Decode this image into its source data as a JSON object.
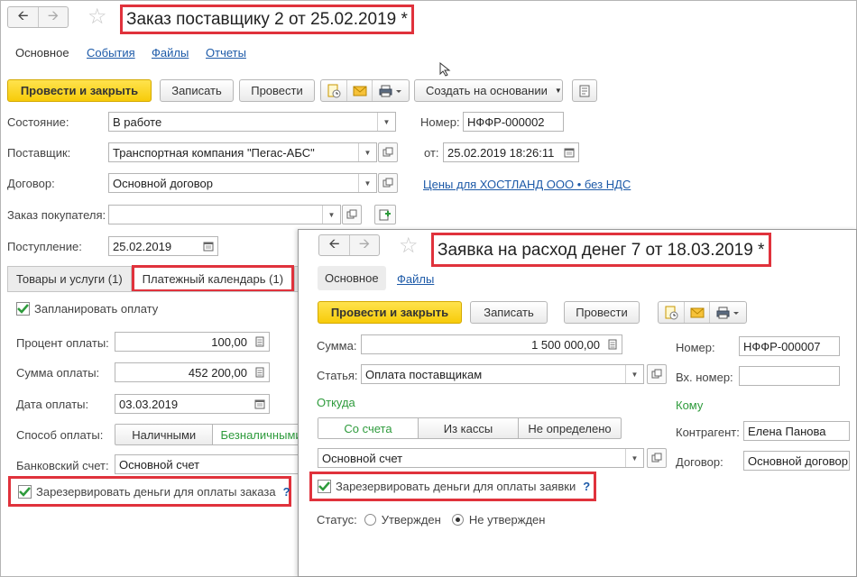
{
  "window1": {
    "title": "Заказ поставщику 2 от 25.02.2019 *",
    "tabs": [
      "Основное",
      "События",
      "Файлы",
      "Отчеты"
    ],
    "toolbar": {
      "post_close": "Провести и закрыть",
      "save": "Записать",
      "post": "Провести",
      "create_based": "Создать на основании"
    },
    "fields": {
      "state_label": "Состояние:",
      "state_value": "В работе",
      "supplier_label": "Поставщик:",
      "supplier_value": "Транспортная компания \"Пегас-АБС\"",
      "contract_label": "Договор:",
      "contract_value": "Основной договор",
      "customer_order_label": "Заказ покупателя:",
      "customer_order_value": "",
      "receipt_label": "Поступление:",
      "receipt_value": "25.02.2019",
      "number_label": "Номер:",
      "number_value": "НФФР-000002",
      "from_label": "от:",
      "from_value": "25.02.2019 18:26:11",
      "prices_link": "Цены для ХОСТЛАНД ООО • без НДС"
    },
    "form_tabs": [
      "Товары и услуги (1)",
      "Платежный календарь (1)"
    ],
    "payment": {
      "plan_label": "Запланировать оплату",
      "percent_label": "Процент оплаты:",
      "percent_value": "100,00",
      "sum_label": "Сумма оплаты:",
      "sum_value": "452 200,00",
      "date_label": "Дата оплаты:",
      "date_value": "03.03.2019",
      "method_label": "Способ оплаты:",
      "method_options": [
        "Наличными",
        "Безналичными"
      ],
      "bank_label": "Банковский счет:",
      "bank_value": "Основной счет",
      "reserve_label": "Зарезервировать деньги для оплаты заказа",
      "help": "?"
    }
  },
  "window2": {
    "title": "Заявка на расход денег 7 от 18.03.2019 *",
    "tabs": [
      "Основное",
      "Файлы"
    ],
    "toolbar": {
      "post_close": "Провести и закрыть",
      "save": "Записать",
      "post": "Провести"
    },
    "fields": {
      "sum_label": "Сумма:",
      "sum_value": "1 500 000,00",
      "article_label": "Статья:",
      "article_value": "Оплата поставщикам",
      "from_header": "Откуда",
      "source_options": [
        "Со счета",
        "Из кассы",
        "Не определено"
      ],
      "account_value": "Основной счет",
      "reserve_label": "Зарезервировать деньги для оплаты заявки",
      "help": "?",
      "status_label": "Статус:",
      "status_options": [
        "Утвержден",
        "Не утвержден"
      ],
      "number_label": "Номер:",
      "number_value": "НФФР-000007",
      "incoming_label": "Вх. номер:",
      "incoming_value": "",
      "to_header": "Кому",
      "counterparty_label": "Контрагент:",
      "counterparty_value": "Елена Панова",
      "contract_label": "Договор:",
      "contract_value": "Основной договор"
    }
  },
  "colors": {
    "accent_yellow": "#f7cb0a",
    "highlight_red": "#e0323c",
    "link_blue": "#1d5aa8",
    "green": "#2e9b3c"
  }
}
